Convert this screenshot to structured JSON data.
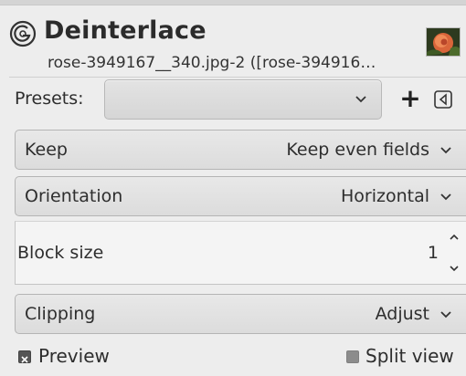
{
  "header": {
    "title": "Deinterlace",
    "subtitle": "rose-3949167__340.jpg-2 ([rose-394916…",
    "icon": "gimp-icon",
    "thumbnail": "rose-thumbnail"
  },
  "presets": {
    "label": "Presets:",
    "value": "",
    "add_label": "+"
  },
  "keep": {
    "label": "Keep",
    "value": "Keep even fields"
  },
  "orientation": {
    "label": "Orientation",
    "value": "Horizontal"
  },
  "block_size": {
    "label": "Block size",
    "value": "1"
  },
  "clipping": {
    "label": "Clipping",
    "value": "Adjust"
  },
  "preview": {
    "label": "Preview",
    "checked": true
  },
  "split_view": {
    "label": "Split view",
    "checked": false
  }
}
